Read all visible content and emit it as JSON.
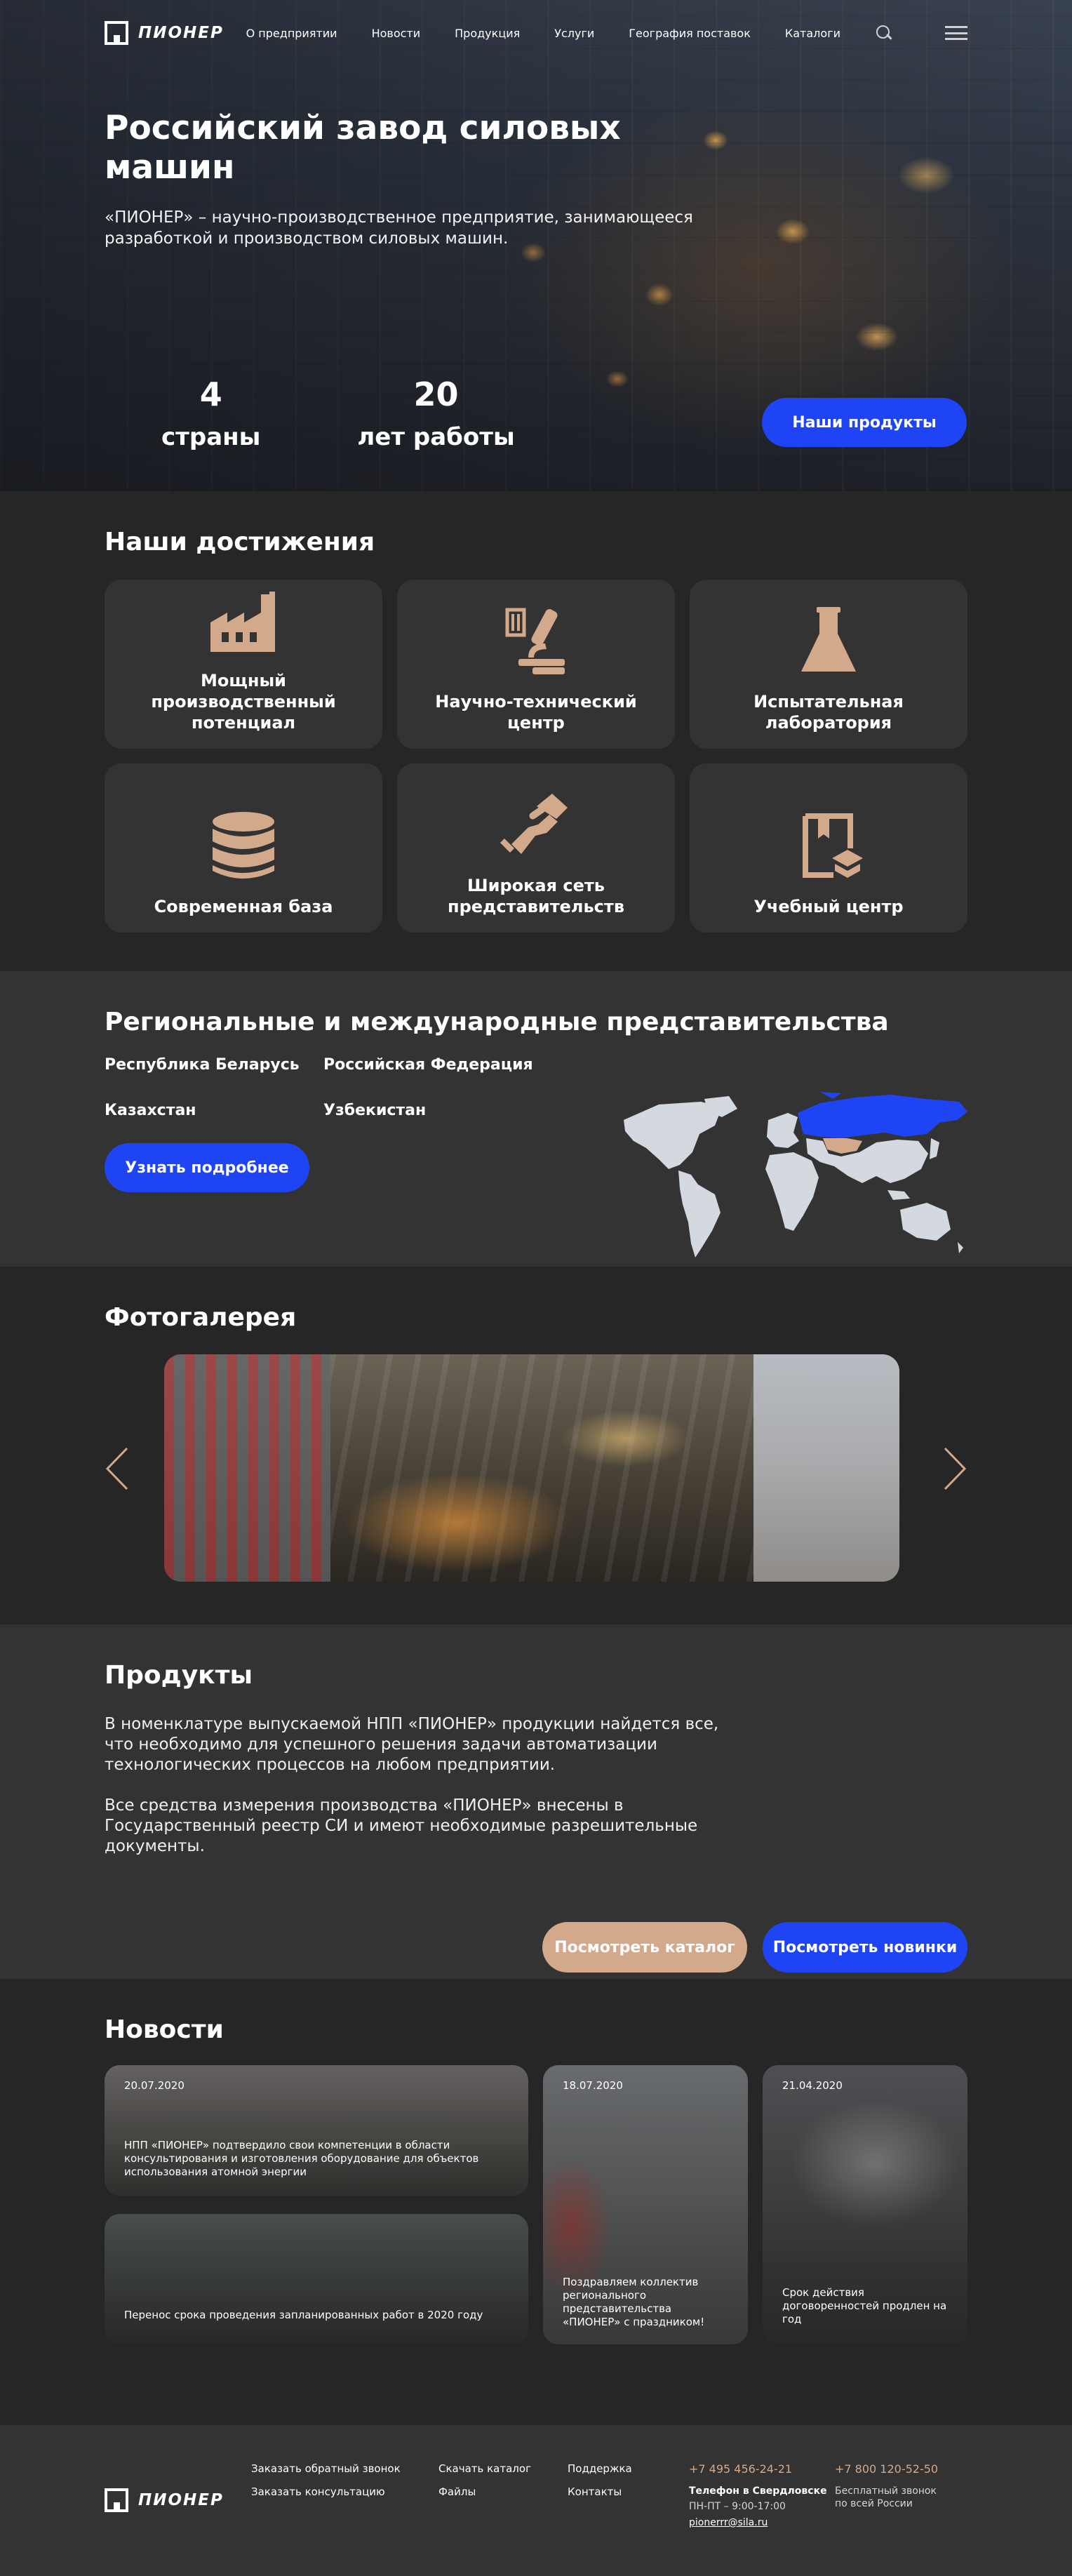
{
  "brand": {
    "name": "ПИОНЕР"
  },
  "nav": {
    "links": [
      "О предприятии",
      "Новости",
      "Продукция",
      "Услуги",
      "География поставок",
      "Каталоги"
    ],
    "icons": [
      "search-icon",
      "menu-icon"
    ]
  },
  "hero": {
    "title": "Российский завод силовых машин",
    "subtitle": "«ПИОНЕР» – научно-производственное предприятие, занимающееся разработкой и производством силовых машин.",
    "stats": [
      {
        "value": "4",
        "label": "страны"
      },
      {
        "value": "20",
        "label": "лет работы"
      }
    ],
    "cta": "Наши продукты"
  },
  "achievements": {
    "title": "Наши достижения",
    "items": [
      {
        "label": "Мощный производственный потенциал",
        "icon": "factory-icon"
      },
      {
        "label": "Научно-технический центр",
        "icon": "microscope-icon"
      },
      {
        "label": "Испытательная лаборатория",
        "icon": "flask-icon"
      },
      {
        "label": "Современная база",
        "icon": "database-icon"
      },
      {
        "label": "Широкая сеть представительств",
        "icon": "handshake-icon"
      },
      {
        "label": "Учебный центр",
        "icon": "book-icon"
      }
    ]
  },
  "regions": {
    "title": "Региональные и международные представительства",
    "items": [
      "Республика Беларусь",
      "Российская Федерация",
      "Казахстан",
      "Узбекистан"
    ],
    "cta": "Узнать подробнее"
  },
  "gallery": {
    "title": "Фотогалерея"
  },
  "products": {
    "title": "Продукты",
    "paragraphs": [
      "В номенклатуре выпускаемой НПП «ПИОНЕР» продукции найдется все, что необходимо для успешного решения задачи автоматизации технологических процессов на любом предприятии.",
      "Все средства измерения производства «ПИОНЕР» внесены в Государственный реестр СИ и имеют необходимые разрешительные документы."
    ],
    "catalog_btn": "Посмотреть каталог",
    "new_btn": "Посмотреть новинки"
  },
  "news": {
    "title": "Новости",
    "items": [
      {
        "date": "20.07.2020",
        "text": "НПП «ПИОНЕР» подтвердило свои компетенции в области консультирования и изготовления оборудование для объектов использования атомной энергии"
      },
      {
        "date": "",
        "text": "Перенос срока проведения запланированных работ в 2020 году"
      },
      {
        "date": "18.07.2020",
        "text": "Поздравляем коллектив регионального представительства «ПИОНЕР» с праздником!"
      },
      {
        "date": "21.04.2020",
        "text": "Срок действия договоренностей продлен на год"
      }
    ]
  },
  "footer": {
    "col1": [
      "Заказать обратный звонок",
      "Заказать консультацию"
    ],
    "col2": [
      "Скачать каталог",
      "Файлы"
    ],
    "col3": [
      "Поддержка",
      "Контакты"
    ],
    "phone1": "+7 495 456-24-21",
    "phone1_label": "Телефон в Свердловске",
    "hours": "ПН-ПТ – 9:00-17:00",
    "email": "pionerrr@sila.ru",
    "phone2": "+7 800 120-52-50",
    "phone2_label": "Бесплатный звонок по всей России"
  },
  "colors": {
    "accent": "#1f44f4",
    "beige": "#d2a98b",
    "bg_dark": "#262626",
    "bg_mid": "#333333"
  }
}
